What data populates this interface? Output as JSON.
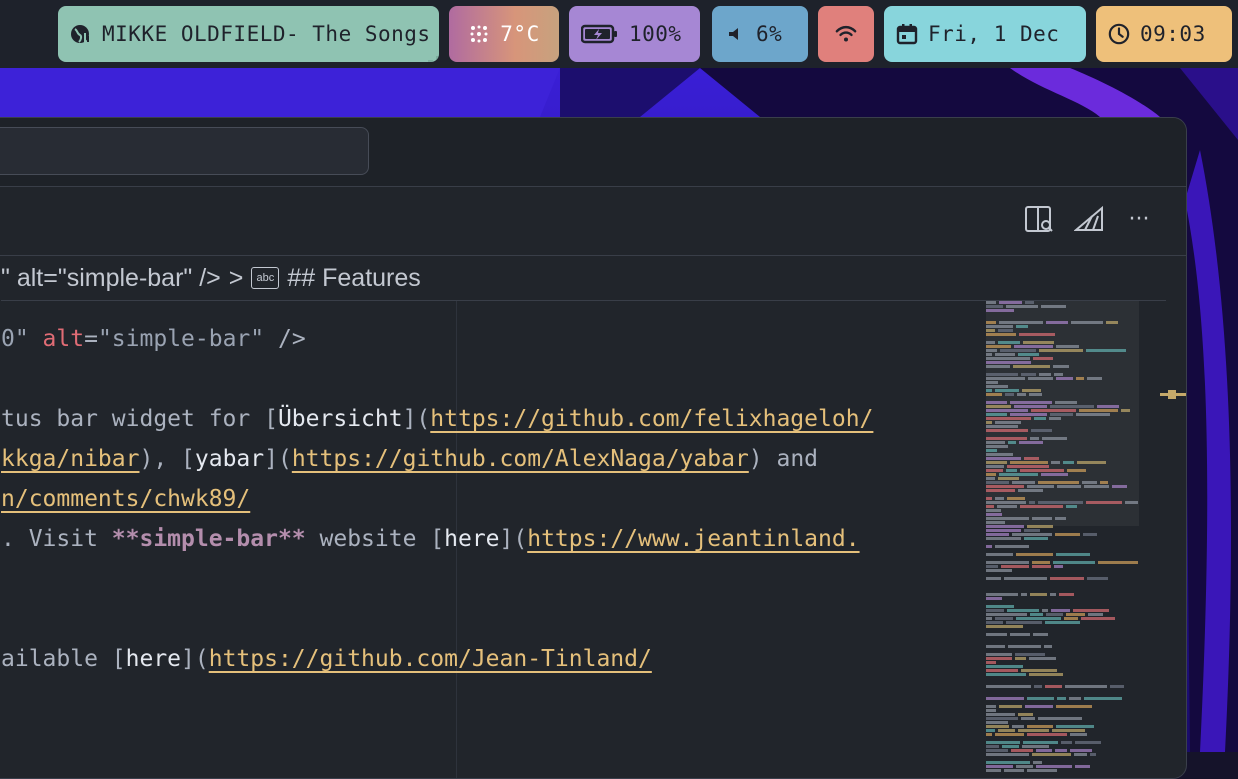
{
  "statusbar": {
    "music": {
      "icon": "music-globe-icon",
      "text": "MIKKE OLDFIELD- The Songs"
    },
    "weather": {
      "icon": "snowflake-icon",
      "text": "7°C"
    },
    "battery": {
      "icon": "battery-charging-icon",
      "text": "100%"
    },
    "volume": {
      "icon": "speaker-icon",
      "text": "6%"
    },
    "wifi": {
      "icon": "wifi-icon"
    },
    "date": {
      "icon": "calendar-icon",
      "text": "Fri, 1 Dec"
    },
    "time": {
      "icon": "clock-icon",
      "text": "09:03"
    }
  },
  "colors": {
    "music": "#8fc3b2",
    "battery": "#a687d4",
    "volume": "#6da6cb",
    "wifi": "#e0807c",
    "date": "#88d5dc",
    "time": "#eec07a",
    "editor_bg": "#21252b",
    "link": "#e5c07b"
  },
  "editor": {
    "toolbar": {
      "icons": [
        "split-search-icon",
        "assistant-icon",
        "more-icon"
      ],
      "more_label": "···"
    },
    "breadcrumb": {
      "segment1": "\" alt=\"simple-bar\" />",
      "separator": ">",
      "abc_label": "abc",
      "segment2": "## Features"
    },
    "lines": {
      "l1": {
        "p1": "0\" ",
        "attr": "alt",
        "p2": "=",
        "str": "\"simple-bar\"",
        "p3": " />"
      },
      "l2": {
        "p1": "tus bar widget for [",
        "word": "Übersicht",
        "p2": "](",
        "link": "https://github.com/felixhageloh/"
      },
      "l3": {
        "link1": "kkga/nibar",
        "p1": "), [",
        "word": "yabar",
        "p2": "](",
        "link2": "https://github.com/AlexNaga/yabar",
        "p3": ") and"
      },
      "l4": {
        "link": "n/comments/chwk89/"
      },
      "l5": {
        "p1": ". Visit ",
        "bold": "**simple-bar**",
        "p2": " website [",
        "word": "here",
        "p3": "](",
        "link": "https://www.jeantinland."
      },
      "l6": {
        "p1": "ailable [",
        "word": "here",
        "p2": "](",
        "link": "https://github.com/Jean-Tinland/"
      }
    }
  }
}
